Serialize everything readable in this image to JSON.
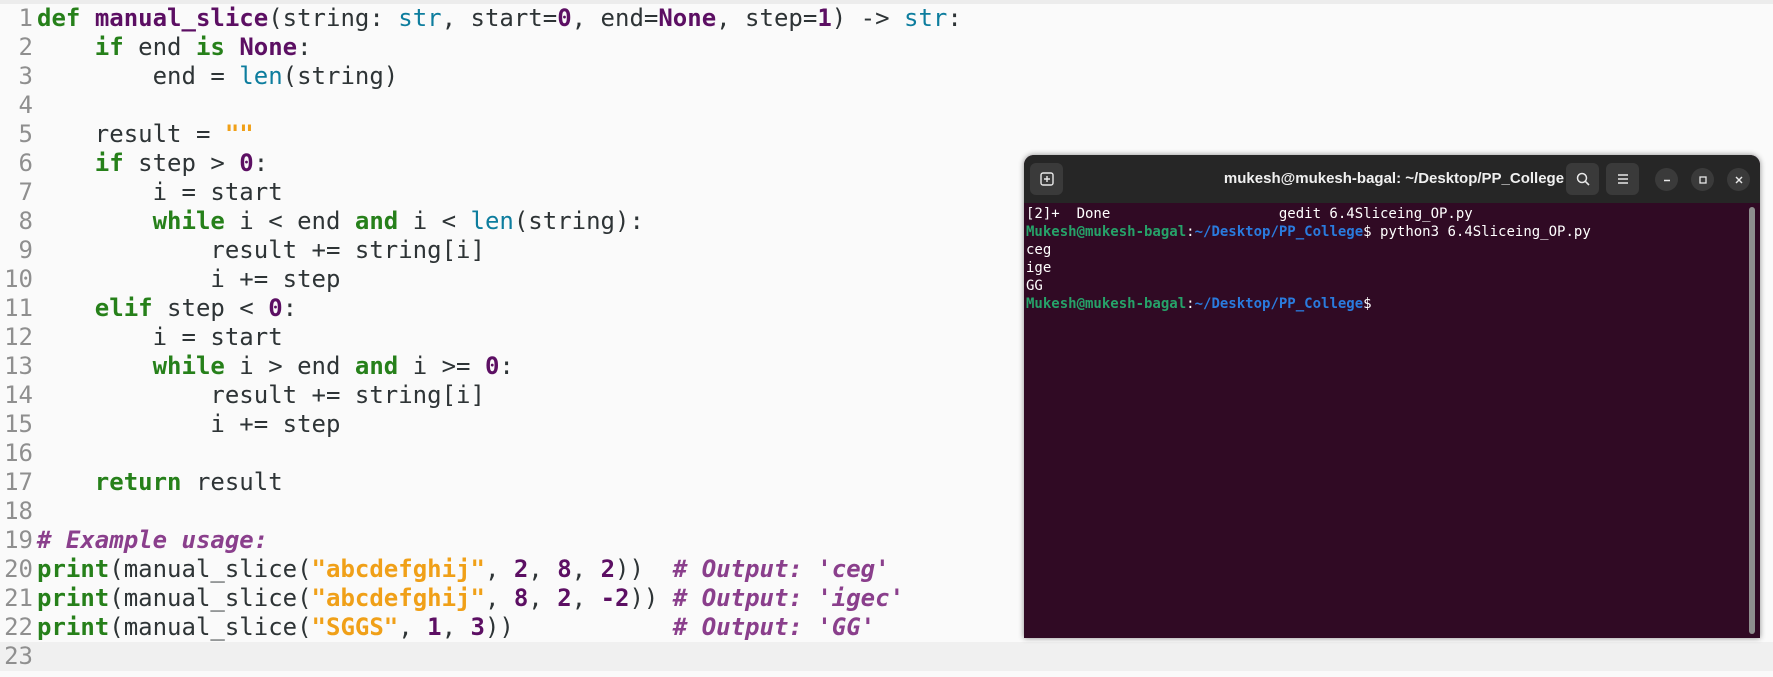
{
  "editor": {
    "lines": [
      {
        "n": "1",
        "tokens": [
          [
            "kw",
            "def"
          ],
          [
            "tx",
            " "
          ],
          [
            "fn",
            "manual_slice"
          ],
          [
            "tx",
            "(string: "
          ],
          [
            "bi",
            "str"
          ],
          [
            "tx",
            ", start="
          ],
          [
            "num",
            "0"
          ],
          [
            "tx",
            ", end="
          ],
          [
            "kc",
            "None"
          ],
          [
            "tx",
            ", step="
          ],
          [
            "num",
            "1"
          ],
          [
            "tx",
            ") -> "
          ],
          [
            "bi",
            "str"
          ],
          [
            "tx",
            ":"
          ]
        ]
      },
      {
        "n": "2",
        "tokens": [
          [
            "tx",
            "    "
          ],
          [
            "kw",
            "if"
          ],
          [
            "tx",
            " end "
          ],
          [
            "kw",
            "is"
          ],
          [
            "tx",
            " "
          ],
          [
            "kc",
            "None"
          ],
          [
            "tx",
            ":"
          ]
        ]
      },
      {
        "n": "3",
        "tokens": [
          [
            "tx",
            "        end = "
          ],
          [
            "bi",
            "len"
          ],
          [
            "tx",
            "(string)"
          ]
        ]
      },
      {
        "n": "4",
        "tokens": []
      },
      {
        "n": "5",
        "tokens": [
          [
            "tx",
            "    result = "
          ],
          [
            "str",
            "\"\""
          ]
        ]
      },
      {
        "n": "6",
        "tokens": [
          [
            "tx",
            "    "
          ],
          [
            "kw",
            "if"
          ],
          [
            "tx",
            " step > "
          ],
          [
            "num",
            "0"
          ],
          [
            "tx",
            ":"
          ]
        ]
      },
      {
        "n": "7",
        "tokens": [
          [
            "tx",
            "        i = start"
          ]
        ]
      },
      {
        "n": "8",
        "tokens": [
          [
            "tx",
            "        "
          ],
          [
            "kw",
            "while"
          ],
          [
            "tx",
            " i < end "
          ],
          [
            "kw",
            "and"
          ],
          [
            "tx",
            " i < "
          ],
          [
            "bi",
            "len"
          ],
          [
            "tx",
            "(string):"
          ]
        ]
      },
      {
        "n": "9",
        "tokens": [
          [
            "tx",
            "            result += string[i]"
          ]
        ]
      },
      {
        "n": "10",
        "tokens": [
          [
            "tx",
            "            i += step"
          ]
        ]
      },
      {
        "n": "11",
        "tokens": [
          [
            "tx",
            "    "
          ],
          [
            "kw",
            "elif"
          ],
          [
            "tx",
            " step < "
          ],
          [
            "num",
            "0"
          ],
          [
            "tx",
            ":"
          ]
        ]
      },
      {
        "n": "12",
        "tokens": [
          [
            "tx",
            "        i = start"
          ]
        ]
      },
      {
        "n": "13",
        "tokens": [
          [
            "tx",
            "        "
          ],
          [
            "kw",
            "while"
          ],
          [
            "tx",
            " i > end "
          ],
          [
            "kw",
            "and"
          ],
          [
            "tx",
            " i >= "
          ],
          [
            "num",
            "0"
          ],
          [
            "tx",
            ":"
          ]
        ]
      },
      {
        "n": "14",
        "tokens": [
          [
            "tx",
            "            result += string[i]"
          ]
        ]
      },
      {
        "n": "15",
        "tokens": [
          [
            "tx",
            "            i += step"
          ]
        ]
      },
      {
        "n": "16",
        "tokens": []
      },
      {
        "n": "17",
        "tokens": [
          [
            "tx",
            "    "
          ],
          [
            "kw",
            "return"
          ],
          [
            "tx",
            " result"
          ]
        ]
      },
      {
        "n": "18",
        "tokens": []
      },
      {
        "n": "19",
        "tokens": [
          [
            "cm",
            "# Example usage:"
          ]
        ]
      },
      {
        "n": "20",
        "tokens": [
          [
            "kw",
            "print"
          ],
          [
            "tx",
            "(manual_slice("
          ],
          [
            "str",
            "\"abcdefghij\""
          ],
          [
            "tx",
            ", "
          ],
          [
            "num",
            "2"
          ],
          [
            "tx",
            ", "
          ],
          [
            "num",
            "8"
          ],
          [
            "tx",
            ", "
          ],
          [
            "num",
            "2"
          ],
          [
            "tx",
            "))  "
          ],
          [
            "cm",
            "# Output: 'ceg'"
          ]
        ]
      },
      {
        "n": "21",
        "tokens": [
          [
            "kw",
            "print"
          ],
          [
            "tx",
            "(manual_slice("
          ],
          [
            "str",
            "\"abcdefghij\""
          ],
          [
            "tx",
            ", "
          ],
          [
            "num",
            "8"
          ],
          [
            "tx",
            ", "
          ],
          [
            "num",
            "2"
          ],
          [
            "tx",
            ", "
          ],
          [
            "num",
            "-2"
          ],
          [
            "tx",
            ")) "
          ],
          [
            "cm",
            "# Output: 'igec'"
          ]
        ]
      },
      {
        "n": "22",
        "tokens": [
          [
            "kw",
            "print"
          ],
          [
            "tx",
            "(manual_slice("
          ],
          [
            "str",
            "\"SGGS\""
          ],
          [
            "tx",
            ", "
          ],
          [
            "num",
            "1"
          ],
          [
            "tx",
            ", "
          ],
          [
            "num",
            "3"
          ],
          [
            "tx",
            "))           "
          ],
          [
            "cm",
            "# Output: 'GG'"
          ]
        ]
      },
      {
        "n": "23",
        "tokens": [],
        "current": true
      }
    ]
  },
  "terminal": {
    "title": "mukesh@mukesh-bagal: ~/Desktop/PP_College",
    "icons": {
      "new_tab": "new-tab-icon",
      "search": "search-icon",
      "menu": "hamburger-menu-icon",
      "minimize": "minimize-icon",
      "maximize": "maximize-icon",
      "close": "close-icon"
    },
    "lines": [
      {
        "type": "text",
        "text": "[2]+  Done                    gedit 6.4Sliceing_OP.py"
      },
      {
        "type": "prompt",
        "user": "Mukesh@mukesh-bagal",
        "colon": ":",
        "path": "~/Desktop/PP_College",
        "dollar": "$",
        "cmd": " python3 6.4Sliceing_OP.py"
      },
      {
        "type": "text",
        "text": "ceg"
      },
      {
        "type": "text",
        "text": "ige"
      },
      {
        "type": "text",
        "text": "GG"
      },
      {
        "type": "prompt",
        "user": "Mukesh@mukesh-bagal",
        "colon": ":",
        "path": "~/Desktop/PP_College",
        "dollar": "$",
        "cmd": ""
      }
    ]
  }
}
